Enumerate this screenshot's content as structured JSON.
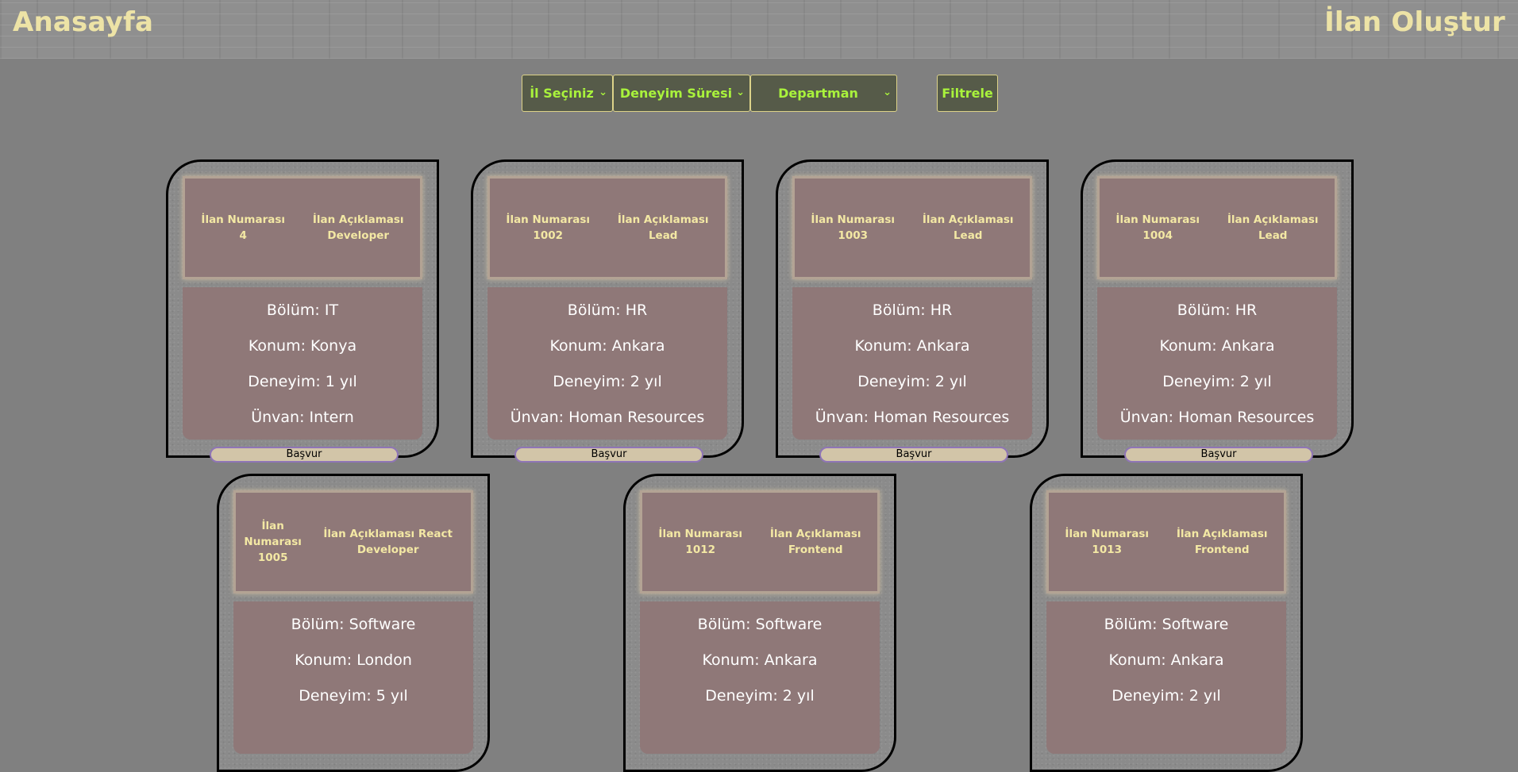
{
  "header": {
    "home_label": "Anasayfa",
    "create_label": "İlan Oluştur"
  },
  "filters": {
    "city_label": "İl Seçiniz",
    "experience_label": "Deneyim Süresi",
    "department_label": "Departman",
    "filter_button_label": "Filtrele"
  },
  "labels": {
    "ad_number": "İlan Numarası",
    "ad_description": "İlan Açıklaması",
    "apply": "Başvur"
  },
  "cards": [
    {
      "number": "4",
      "description": "Developer",
      "department": "Bölüm: IT",
      "location": "Konum: Konya",
      "experience": "Deneyim: 1 yıl",
      "title": "Ünvan: Intern"
    },
    {
      "number": "1002",
      "description": "Lead",
      "department": "Bölüm: HR",
      "location": "Konum: Ankara",
      "experience": "Deneyim: 2 yıl",
      "title": "Ünvan: Homan Resources"
    },
    {
      "number": "1003",
      "description": "Lead",
      "department": "Bölüm: HR",
      "location": "Konum: Ankara",
      "experience": "Deneyim: 2 yıl",
      "title": "Ünvan: Homan Resources"
    },
    {
      "number": "1004",
      "description": "Lead",
      "department": "Bölüm: HR",
      "location": "Konum: Ankara",
      "experience": "Deneyim: 2 yıl",
      "title": "Ünvan: Homan Resources"
    },
    {
      "number": "1005",
      "description": "React Developer",
      "department": "Bölüm: Software",
      "location": "Konum: London",
      "experience": "Deneyim: 5 yıl",
      "title": ""
    },
    {
      "number": "1012",
      "description": "Frontend",
      "department": "Bölüm: Software",
      "location": "Konum: Ankara",
      "experience": "Deneyim: 2 yıl",
      "title": ""
    },
    {
      "number": "1013",
      "description": "Frontend",
      "department": "Bölüm: Software",
      "location": "Konum: Ankara",
      "experience": "Deneyim: 2 yıl",
      "title": ""
    }
  ],
  "colors": {
    "background": "#808080",
    "brand_text": "#ede3a6",
    "filter_text": "#a9f23c",
    "card_panel": "#8f7878",
    "card_heading_text": "#f3e8a4",
    "apply_button": "#d2c5a8"
  }
}
